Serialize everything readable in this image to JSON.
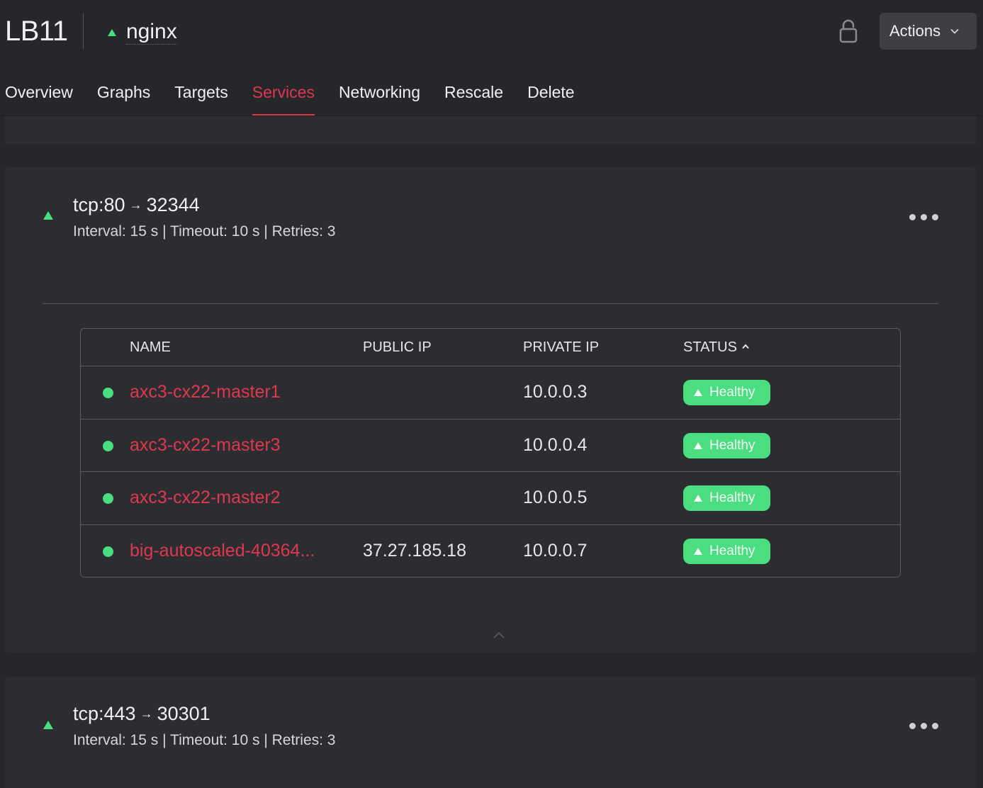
{
  "header": {
    "lb_name": "LB11",
    "label": "nginx",
    "actions_label": "Actions"
  },
  "tabs": [
    {
      "label": "Overview"
    },
    {
      "label": "Graphs"
    },
    {
      "label": "Targets"
    },
    {
      "label": "Services",
      "active": true
    },
    {
      "label": "Networking"
    },
    {
      "label": "Rescale"
    },
    {
      "label": "Delete"
    }
  ],
  "services": [
    {
      "protocol_port": "tcp:80",
      "arrow": "→",
      "destination_port": "32344",
      "interval": "Interval: 15 s",
      "timeout": "Timeout: 10 s",
      "retries": "Retries: 3",
      "separator": "|",
      "table": {
        "headers": {
          "name": "NAME",
          "public_ip": "PUBLIC IP",
          "private_ip": "PRIVATE IP",
          "status": "STATUS"
        },
        "rows": [
          {
            "name": "axc3-cx22-master1",
            "public_ip": "",
            "private_ip": "10.0.0.3",
            "status": "Healthy"
          },
          {
            "name": "axc3-cx22-master3",
            "public_ip": "",
            "private_ip": "10.0.0.4",
            "status": "Healthy"
          },
          {
            "name": "axc3-cx22-master2",
            "public_ip": "",
            "private_ip": "10.0.0.5",
            "status": "Healthy"
          },
          {
            "name": "big-autoscaled-40364...",
            "public_ip": "37.27.185.18",
            "private_ip": "10.0.0.7",
            "status": "Healthy"
          }
        ]
      }
    },
    {
      "protocol_port": "tcp:443",
      "arrow": "→",
      "destination_port": "30301",
      "interval": "Interval: 15 s",
      "timeout": "Timeout: 10 s",
      "retries": "Retries: 3",
      "separator": "|"
    }
  ],
  "colors": {
    "accent": "#e0374f",
    "healthy": "#4ade80",
    "background": "#26272b",
    "card": "#2c2d31"
  }
}
